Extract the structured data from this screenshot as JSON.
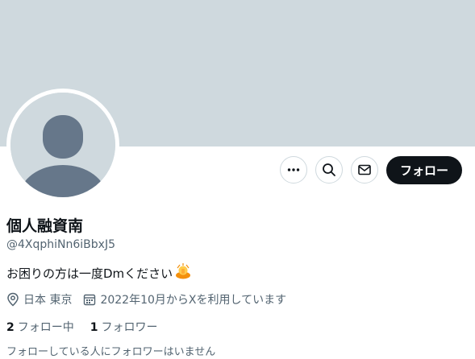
{
  "profile": {
    "display_name": "個人融資南",
    "handle": "@4XqphiNn6iBbxJ5",
    "bio": "お困りの方は一度Dmください",
    "bio_emoji": "pray-emoji",
    "location": "日本 東京",
    "joined": "2022年10月からXを利用しています"
  },
  "stats": {
    "following_count": "2",
    "following_label": "フォロー中",
    "followers_count": "1",
    "followers_label": "フォロワー"
  },
  "followed_by_note": "フォローしている人にフォロワーはいません",
  "actions": {
    "follow_label": "フォロー",
    "more_icon": "more-icon",
    "search_icon": "search-icon",
    "message_icon": "mail-icon"
  },
  "colors": {
    "banner": "#cfd9de",
    "avatar_silhouette": "#66778a",
    "follow_button_bg": "#0f1419",
    "secondary_text": "#536471"
  }
}
